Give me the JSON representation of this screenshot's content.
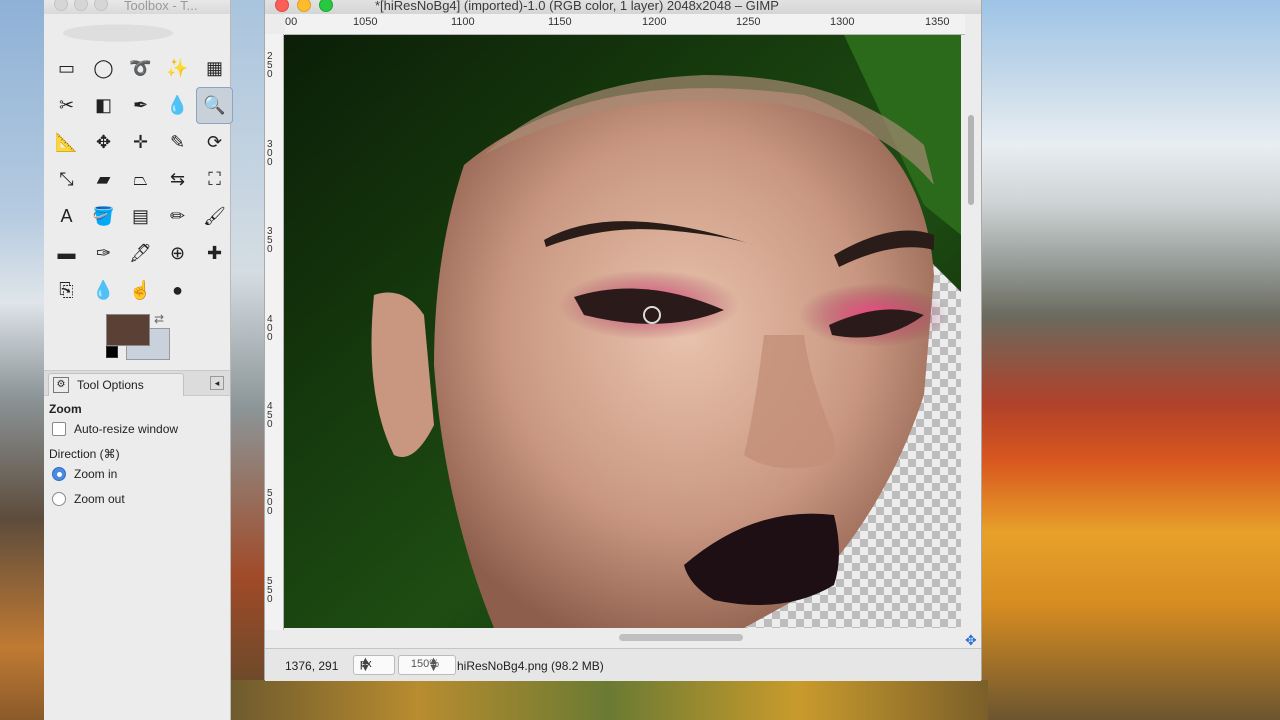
{
  "toolbox": {
    "title": "Toolbox - T...",
    "tools": [
      {
        "name": "rect-select-icon",
        "glyph": "▭"
      },
      {
        "name": "ellipse-select-icon",
        "glyph": "◯"
      },
      {
        "name": "free-select-icon",
        "glyph": "➰"
      },
      {
        "name": "fuzzy-select-icon",
        "glyph": "✨"
      },
      {
        "name": "select-by-color-icon",
        "glyph": "▦"
      },
      {
        "name": "scissors-select-icon",
        "glyph": "✂"
      },
      {
        "name": "foreground-select-icon",
        "glyph": "◧"
      },
      {
        "name": "paths-icon",
        "glyph": "✒"
      },
      {
        "name": "color-picker-icon",
        "glyph": "💧"
      },
      {
        "name": "zoom-icon",
        "glyph": "🔍",
        "selected": true
      },
      {
        "name": "measure-icon",
        "glyph": "📐"
      },
      {
        "name": "move-icon",
        "glyph": "✥"
      },
      {
        "name": "align-icon",
        "glyph": "✛"
      },
      {
        "name": "crop-icon",
        "glyph": "✎"
      },
      {
        "name": "rotate-icon",
        "glyph": "⟳"
      },
      {
        "name": "scale-icon",
        "glyph": "⤡"
      },
      {
        "name": "shear-icon",
        "glyph": "▰"
      },
      {
        "name": "perspective-icon",
        "glyph": "⏢"
      },
      {
        "name": "flip-icon",
        "glyph": "⇆"
      },
      {
        "name": "cage-icon",
        "glyph": "⛶"
      },
      {
        "name": "text-icon",
        "glyph": "A"
      },
      {
        "name": "bucket-fill-icon",
        "glyph": "🪣"
      },
      {
        "name": "blend-icon",
        "glyph": "▤"
      },
      {
        "name": "pencil-icon",
        "glyph": "✏"
      },
      {
        "name": "paintbrush-icon",
        "glyph": "🖌"
      },
      {
        "name": "eraser-icon",
        "glyph": "▬"
      },
      {
        "name": "airbrush-icon",
        "glyph": "✑"
      },
      {
        "name": "ink-icon",
        "glyph": "🖋"
      },
      {
        "name": "clone-icon",
        "glyph": "⊕"
      },
      {
        "name": "heal-icon",
        "glyph": "✚"
      },
      {
        "name": "perspective-clone-icon",
        "glyph": "⎘"
      },
      {
        "name": "blur-icon",
        "glyph": "💧"
      },
      {
        "name": "smudge-icon",
        "glyph": "☝"
      },
      {
        "name": "dodge-burn-icon",
        "glyph": "●"
      }
    ],
    "fg_color": "#5a4035",
    "bg_color": "#c9d2dc",
    "tool_options_label": "Tool Options",
    "zoom_heading": "Zoom",
    "auto_resize_label": "Auto-resize window",
    "direction_label": "Direction  (⌘)",
    "zoom_in_label": "Zoom in",
    "zoom_out_label": "Zoom out"
  },
  "image_window": {
    "title": "*[hiResNoBg4] (imported)-1.0 (RGB color, 1 layer) 2048x2048 – GIMP",
    "hruler_ticks": [
      "00",
      "1050",
      "1100",
      "1150",
      "1200",
      "1250",
      "1300",
      "1350"
    ],
    "vruler_ticks": [
      "2\n5\n0",
      "3\n0\n0",
      "3\n5\n0",
      "4\n0\n0",
      "4\n5\n0",
      "5\n0\n0",
      "5\n5\n0"
    ],
    "status": {
      "coords": "1376, 291",
      "unit": "px",
      "zoom": "150%",
      "file_info": "hiResNoBg4.png (98.2 MB)"
    }
  }
}
